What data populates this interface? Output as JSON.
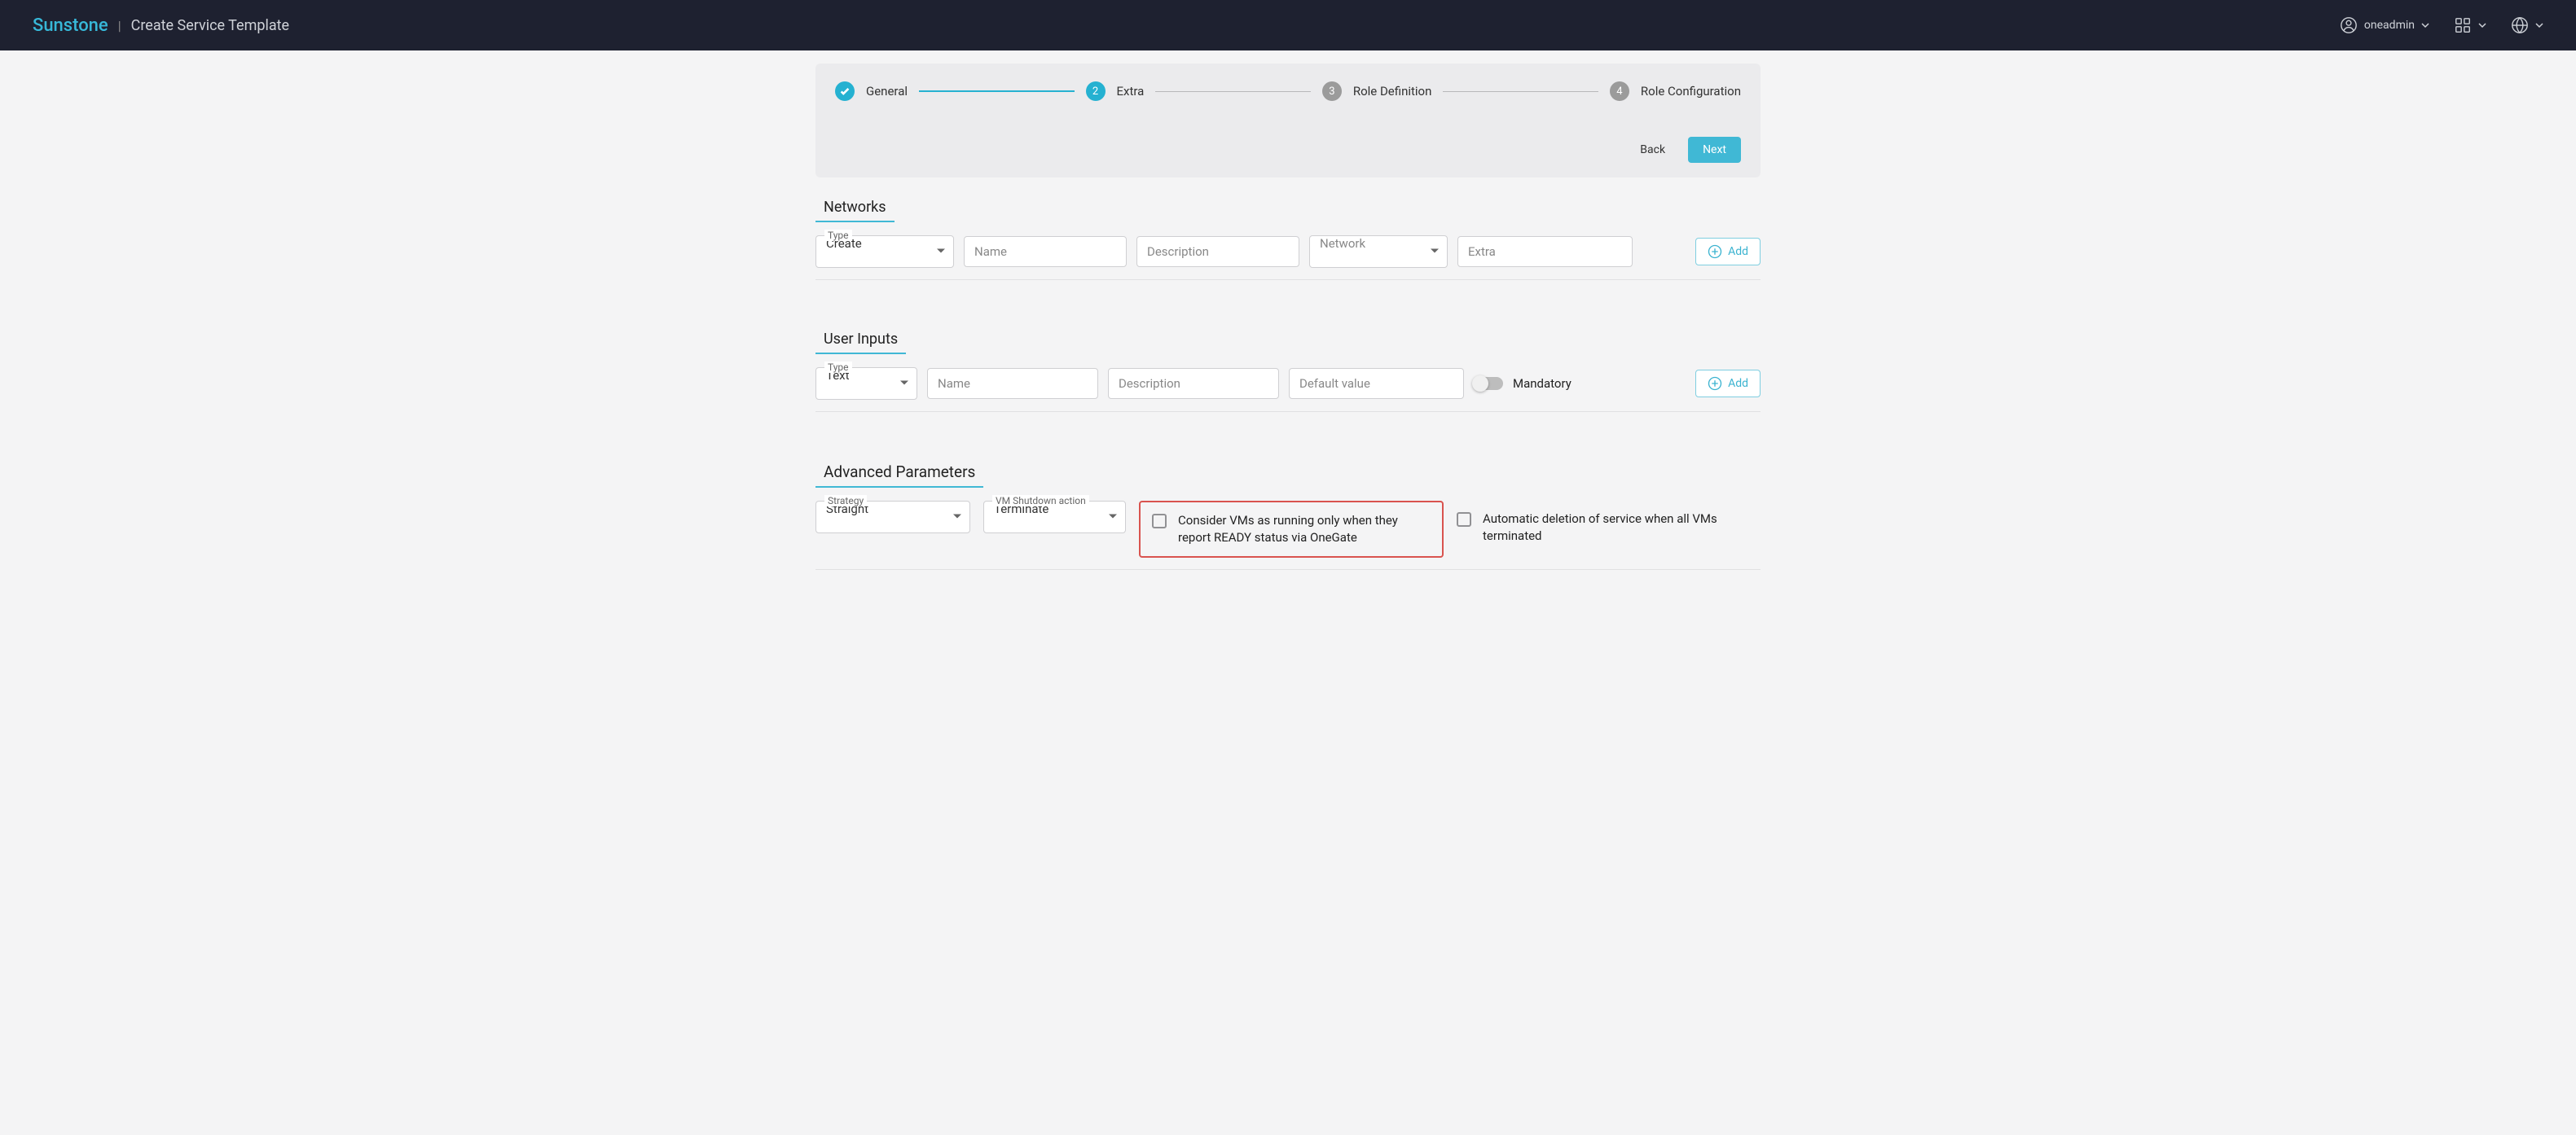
{
  "header": {
    "brand": "Sunstone",
    "page_title": "Create Service Template",
    "username": "oneadmin"
  },
  "stepper": {
    "steps": [
      {
        "label": "General",
        "num": "✓"
      },
      {
        "label": "Extra",
        "num": "2"
      },
      {
        "label": "Role Definition",
        "num": "3"
      },
      {
        "label": "Role Configuration",
        "num": "4"
      }
    ],
    "back": "Back",
    "next": "Next"
  },
  "sections": {
    "networks": {
      "title": "Networks",
      "type_label": "Type",
      "type_value": "Create",
      "name_ph": "Name",
      "desc_ph": "Description",
      "network_ph": "Network",
      "extra_ph": "Extra",
      "add": "Add"
    },
    "user_inputs": {
      "title": "User Inputs",
      "type_label": "Type",
      "type_value": "Text",
      "name_ph": "Name",
      "desc_ph": "Description",
      "default_ph": "Default value",
      "mandatory": "Mandatory",
      "add": "Add"
    },
    "advanced": {
      "title": "Advanced Parameters",
      "strategy_label": "Strategy",
      "strategy_value": "Straight",
      "shutdown_label": "VM Shutdown action",
      "shutdown_value": "Terminate",
      "ready_text": "Consider VMs as running only when they report READY status via OneGate",
      "auto_delete_text": "Automatic deletion of service when all VMs terminated"
    }
  }
}
